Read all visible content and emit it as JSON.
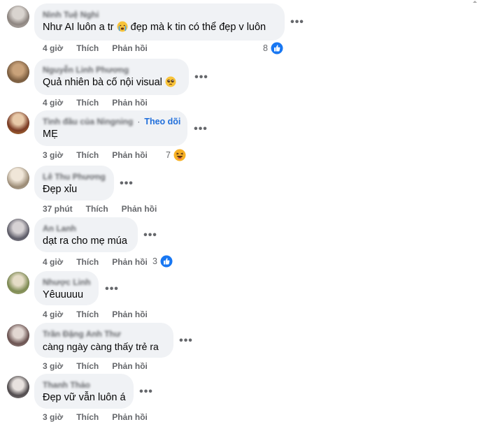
{
  "comments": [
    {
      "name": "Nình Tuệ Nghi",
      "text_before": "Như AI luôn a tr",
      "text_emoji": "crying-face-emoji",
      "text_after": "đẹp mà k tin có thể đẹp v luôn",
      "time": "4 giờ",
      "like": "Thích",
      "reply": "Phản hồi",
      "reaction_count": "8",
      "reaction": "like-icon"
    },
    {
      "name": "Nguyễn Linh Phương",
      "text": "Quả nhiên bà cố nội visual",
      "text_emoji": "pleading-face-emoji",
      "time": "4 giờ",
      "like": "Thích",
      "reply": "Phản hồi"
    },
    {
      "name": "Tình đầu của Ningning",
      "follow": "Theo dõi",
      "text": "MẸ",
      "time": "3 giờ",
      "like": "Thích",
      "reply": "Phản hồi",
      "reaction_count": "7",
      "reaction": "haha-icon"
    },
    {
      "name": "Lê Thu Phương",
      "text": "Đẹp xỉu",
      "time": "37 phút",
      "like": "Thích",
      "reply": "Phản hồi"
    },
    {
      "name": "An Lanh",
      "text": "dạt ra cho mẹ múa",
      "time": "4 giờ",
      "like": "Thích",
      "reply": "Phản hồi",
      "reaction_count": "3",
      "reaction": "like-icon"
    },
    {
      "name": "Nhược Linh",
      "text": "Yêuuuuu",
      "time": "4 giờ",
      "like": "Thích",
      "reply": "Phản hồi"
    },
    {
      "name": "Trần Đặng Anh Thư",
      "text": "càng ngày càng thấy trẻ ra",
      "time": "3 giờ",
      "like": "Thích",
      "reply": "Phản hồi"
    },
    {
      "name": "Thanh Thảo",
      "text": "Đẹp vữ vẫn luôn á",
      "time": "3 giờ",
      "like": "Thích",
      "reply": "Phản hồi"
    }
  ],
  "more_glyph": "•••",
  "colors": {
    "bubble": "#f0f2f5",
    "meta_text": "#65676b",
    "follow": "#216fdb",
    "like_blue": "#0866ff"
  }
}
